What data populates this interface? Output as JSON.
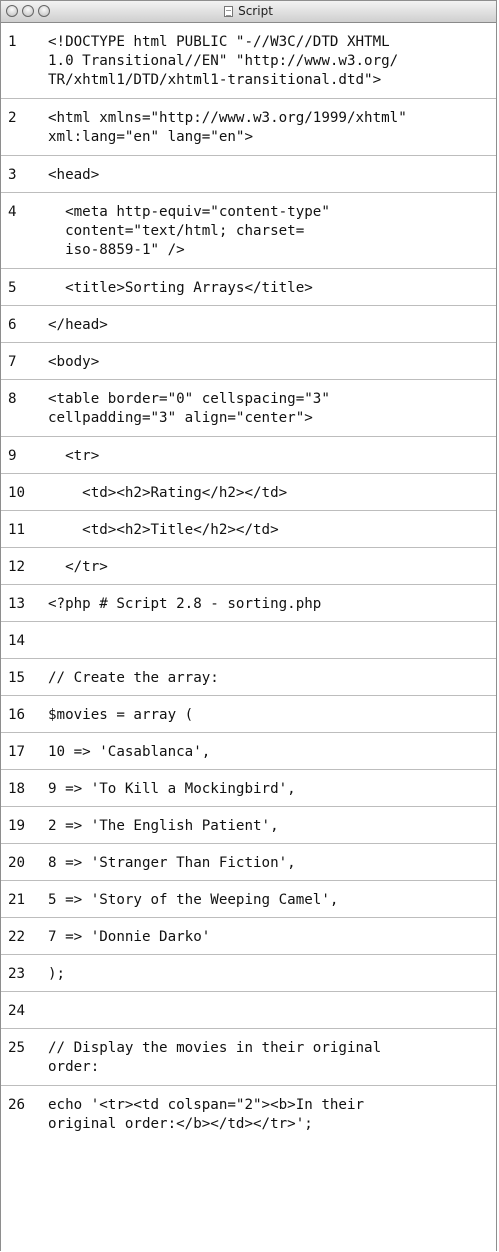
{
  "window": {
    "title": "Script"
  },
  "lines": [
    {
      "num": "1",
      "text": "<!DOCTYPE html PUBLIC \"-//W3C//DTD XHTML\n1.0 Transitional//EN\" \"http://www.w3.org/\nTR/xhtml1/DTD/xhtml1-transitional.dtd\">"
    },
    {
      "num": "2",
      "text": "<html xmlns=\"http://www.w3.org/1999/xhtml\"\nxml:lang=\"en\" lang=\"en\">"
    },
    {
      "num": "3",
      "text": "<head>"
    },
    {
      "num": "4",
      "text": "  <meta http-equiv=\"content-type\"\n  content=\"text/html; charset=\n  iso-8859-1\" />"
    },
    {
      "num": "5",
      "text": "  <title>Sorting Arrays</title>"
    },
    {
      "num": "6",
      "text": "</head>"
    },
    {
      "num": "7",
      "text": "<body>"
    },
    {
      "num": "8",
      "text": "<table border=\"0\" cellspacing=\"3\"\ncellpadding=\"3\" align=\"center\">"
    },
    {
      "num": "9",
      "text": "  <tr>"
    },
    {
      "num": "10",
      "text": "    <td><h2>Rating</h2></td>"
    },
    {
      "num": "11",
      "text": "    <td><h2>Title</h2></td>"
    },
    {
      "num": "12",
      "text": "  </tr>"
    },
    {
      "num": "13",
      "text": "<?php # Script 2.8 - sorting.php"
    },
    {
      "num": "14",
      "text": ""
    },
    {
      "num": "15",
      "text": "// Create the array:"
    },
    {
      "num": "16",
      "text": "$movies = array ("
    },
    {
      "num": "17",
      "text": "10 => 'Casablanca',"
    },
    {
      "num": "18",
      "text": "9 => 'To Kill a Mockingbird',"
    },
    {
      "num": "19",
      "text": "2 => 'The English Patient',"
    },
    {
      "num": "20",
      "text": "8 => 'Stranger Than Fiction',"
    },
    {
      "num": "21",
      "text": "5 => 'Story of the Weeping Camel',"
    },
    {
      "num": "22",
      "text": "7 => 'Donnie Darko'"
    },
    {
      "num": "23",
      "text": ");"
    },
    {
      "num": "24",
      "text": ""
    },
    {
      "num": "25",
      "text": "// Display the movies in their original\norder:"
    },
    {
      "num": "26",
      "text": "echo '<tr><td colspan=\"2\"><b>In their\noriginal order:</b></td></tr>';"
    }
  ]
}
